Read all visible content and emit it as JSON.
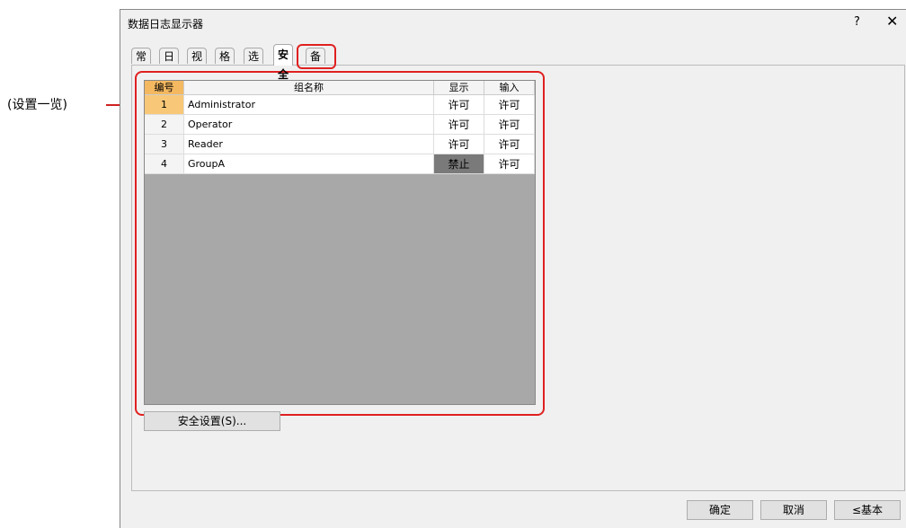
{
  "annotation": {
    "label": "(设置一览)"
  },
  "dialog": {
    "title": "数据日志显示器",
    "help_label": "?",
    "close_label": "✕",
    "tabs": [
      "常规",
      "日志",
      "视图",
      "格式",
      "选项",
      "安全",
      "备注"
    ],
    "active_tab": "安全"
  },
  "table": {
    "columns": [
      "编号",
      "组名称",
      "显示",
      "输入"
    ],
    "rows": [
      {
        "no": "1",
        "name": "Administrator",
        "display": "许可",
        "input": "许可"
      },
      {
        "no": "2",
        "name": "Operator",
        "display": "许可",
        "input": "许可"
      },
      {
        "no": "3",
        "name": "Reader",
        "display": "许可",
        "input": "许可"
      },
      {
        "no": "4",
        "name": "GroupA",
        "display": "禁止",
        "input": "许可"
      }
    ]
  },
  "buttons": {
    "security_settings": "安全设置(S)...",
    "ok": "确定",
    "cancel": "取消",
    "basic": "≤基本"
  },
  "colors": {
    "highlight": "#e02020",
    "denied_cell": "#7a7a7a",
    "selected_header": "#f4b860"
  }
}
